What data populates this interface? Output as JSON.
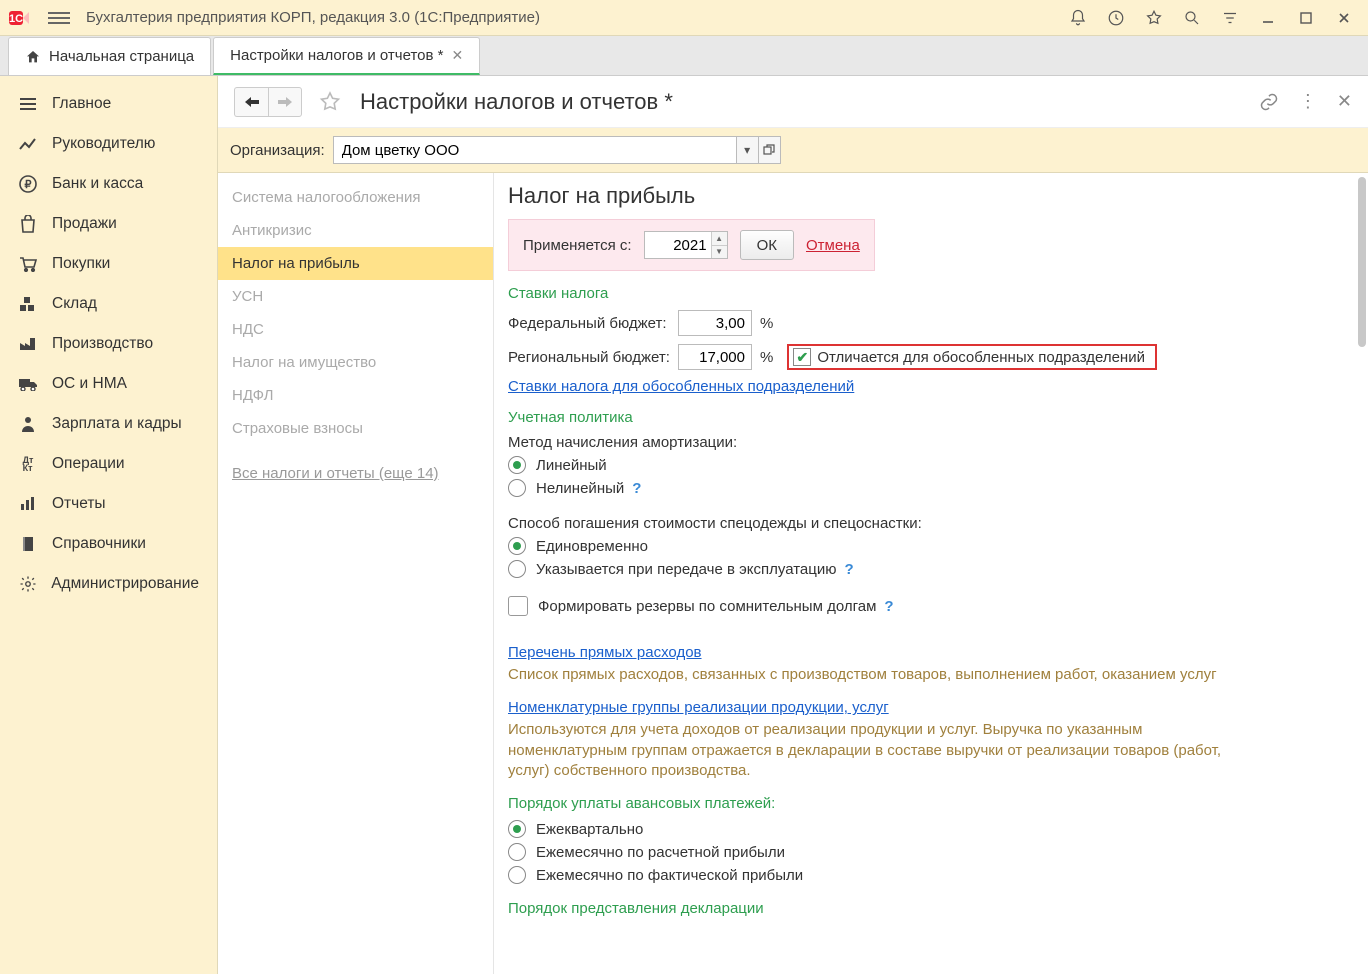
{
  "titlebar": {
    "app_title": "Бухгалтерия предприятия КОРП, редакция 3.0  (1С:Предприятие)"
  },
  "tabs": {
    "home": "Начальная страница",
    "active": "Настройки налогов и отчетов *"
  },
  "leftnav": [
    "Главное",
    "Руководителю",
    "Банк и касса",
    "Продажи",
    "Покупки",
    "Склад",
    "Производство",
    "ОС и НМА",
    "Зарплата и кадры",
    "Операции",
    "Отчеты",
    "Справочники",
    "Администрирование"
  ],
  "form": {
    "title": "Настройки налогов и отчетов *",
    "org_label": "Организация:",
    "org_value": "Дом цветку ООО"
  },
  "subnav": {
    "items": [
      "Система налогообложения",
      "Антикризис",
      "Налог на прибыль",
      "УСН",
      "НДС",
      "Налог на имущество",
      "НДФЛ",
      "Страховые взносы"
    ],
    "all_link": "Все налоги и отчеты (еще 14)"
  },
  "profit": {
    "heading": "Налог на прибыль",
    "applies_label": "Применяется с:",
    "year": "2021",
    "ok": "ОК",
    "cancel": "Отмена",
    "rates_title": "Ставки налога",
    "federal_label": "Федеральный бюджет:",
    "federal_value": "3,00",
    "regional_label": "Региональный бюджет:",
    "regional_value": "17,000",
    "percent": "%",
    "differs_label": "Отличается для обособленных подразделений",
    "rates_link": "Ставки налога для обособленных подразделений",
    "policy_title": "Учетная политика",
    "amort_label": "Метод начисления амортизации:",
    "amort_linear": "Линейный",
    "amort_nonlinear": "Нелинейный",
    "workwear_label": "Способ погашения стоимости спецодежды и спецоснастки:",
    "workwear_once": "Единовременно",
    "workwear_on_transfer": "Указывается при передаче в эксплуатацию",
    "reserve_label": "Формировать резервы по сомнительным долгам",
    "direct_link": "Перечень прямых расходов",
    "direct_desc": "Список прямых расходов, связанных с производством товаров, выполнением работ, оказанием услуг",
    "nomen_link": "Номенклатурные группы реализации продукции, услуг",
    "nomen_desc": "Используются для учета доходов от реализации продукции и услуг. Выручка по указанным номенклатурным группам отражается в декларации в составе выручки от реализации товаров (работ, услуг) собственного производства.",
    "advance_title": "Порядок уплаты авансовых платежей:",
    "advance_q": "Ежеквартально",
    "advance_m_calc": "Ежемесячно по расчетной прибыли",
    "advance_m_fact": "Ежемесячно по фактической прибыли",
    "declaration_title": "Порядок представления декларации",
    "help": "?"
  }
}
